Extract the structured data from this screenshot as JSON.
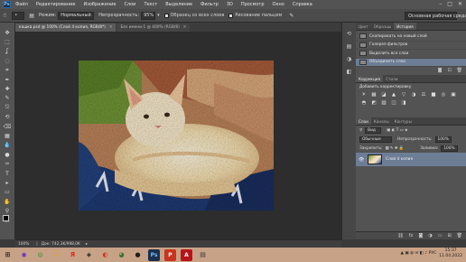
{
  "menu": {
    "logo": "Ps",
    "items": [
      "Файл",
      "Редактирование",
      "Изображение",
      "Слои",
      "Текст",
      "Выделение",
      "Фильтр",
      "3D",
      "Просмотр",
      "Окно",
      "Справка"
    ],
    "window_controls": [
      "–",
      "□",
      "✕"
    ]
  },
  "options": {
    "mode_label": "Режим:",
    "mode_value": "Нормальный",
    "opacity_label": "Непрозрачность:",
    "opacity_value": "95%",
    "all_layers_label": "Образец со всех слоев",
    "finger_paint_label": "Рисование пальцем",
    "workspace": "Основная рабочая среда"
  },
  "doc_tabs": [
    {
      "label": "кошка.psd @ 100% (Слой 4 копия, RGB/8*)",
      "active": true
    },
    {
      "label": "Без имени-1 @ 400% (RGB/8)",
      "active": false
    }
  ],
  "toolbar": {
    "icons": [
      "move-icon",
      "marquee-icon",
      "lasso-icon",
      "quick-select-icon",
      "crop-icon",
      "eyedropper-icon",
      "healing-icon",
      "brush-icon",
      "clone-stamp-icon",
      "history-brush-icon",
      "eraser-icon",
      "gradient-icon",
      "blur-icon",
      "dodge-icon",
      "pen-icon",
      "type-icon",
      "path-select-icon",
      "shape-icon",
      "hand-icon",
      "zoom-icon",
      "extra-icon"
    ],
    "glyphs": [
      "✥",
      "⬚",
      "ʆ",
      "◌",
      "⌗",
      "✒",
      "✚",
      "✎",
      "⎋",
      "⟲",
      "⌫",
      "▦",
      "💧",
      "●",
      "✑",
      "T",
      "▸",
      "▭",
      "✋",
      "⚲",
      "…"
    ],
    "fg_color": "#000000",
    "bg_color": "#ffffff"
  },
  "status": {
    "zoom": "100%",
    "doc_size": "Док: 742,3K/998,0K"
  },
  "dock_icons": [
    "history-dock-icon",
    "properties-dock-icon",
    "adjust-dock-icon",
    "layers-dock-icon"
  ],
  "history_panel": {
    "tabs": [
      "Цвет",
      "Образцы",
      "История"
    ],
    "active_tab": 2,
    "items": [
      {
        "label": "Скопировать на новый слой",
        "selected": false
      },
      {
        "label": "Галерея фильтров",
        "selected": false
      },
      {
        "label": "Выделить все слои",
        "selected": false
      },
      {
        "label": "Объединить слои",
        "selected": true
      }
    ]
  },
  "adjust_panel": {
    "tabs": [
      "Коррекция",
      "Стили"
    ],
    "active_tab": 0,
    "title": "Добавить корректировку",
    "glyphs": [
      "☀",
      "▦",
      "◪",
      "▲",
      "▽",
      "◑",
      "⚖",
      "■",
      "◎",
      "▣",
      "◓",
      "◩",
      "▨",
      "◫",
      "◨"
    ]
  },
  "layers_panel": {
    "tabs": [
      "Слои",
      "Каналы",
      "Контуры"
    ],
    "active_tab": 0,
    "kind_label": "Вид",
    "blend": "Обычные",
    "opacity_label": "Непрозрачность:",
    "opacity_value": "100%",
    "lock_label": "Закрепить:",
    "fill_label": "Заливка:",
    "fill_value": "100%",
    "layers": [
      {
        "name": "Слой 4 копия",
        "selected": true
      }
    ]
  },
  "taskbar": {
    "items": [
      {
        "glyph": "⊞",
        "color": "#1e1e1e",
        "bg": "",
        "name": "start-icon"
      },
      {
        "glyph": "◉",
        "color": "#6a2cc9",
        "bg": "",
        "name": "app-icon"
      },
      {
        "glyph": "◎",
        "color": "#1a8a2a",
        "bg": "",
        "name": "app-icon"
      },
      {
        "glyph": "🗀",
        "color": "#d9a21f",
        "bg": "",
        "name": "folder-icon"
      },
      {
        "glyph": "Я",
        "color": "#e0261b",
        "bg": "",
        "name": "yandex-icon"
      },
      {
        "glyph": "◈",
        "color": "#222",
        "bg": "",
        "name": "app-icon"
      },
      {
        "glyph": "◐",
        "color": "#d9291c",
        "bg": "",
        "name": "opera-icon"
      },
      {
        "glyph": "◕",
        "color": "#2b7a2b",
        "bg": "",
        "name": "chrome-icon"
      },
      {
        "glyph": "●",
        "color": "#1e1e1e",
        "bg": "",
        "name": "app-icon"
      },
      {
        "glyph": "Ps",
        "color": "#7bbcf5",
        "bg": "#1a2f4f",
        "name": "photoshop-icon"
      },
      {
        "glyph": "P",
        "color": "#ffffff",
        "bg": "#c8341e",
        "name": "powerpoint-icon"
      },
      {
        "glyph": "A",
        "color": "#ffffff",
        "bg": "#b8131a",
        "name": "acrobat-icon"
      },
      {
        "glyph": "▤",
        "color": "#333",
        "bg": "",
        "name": "app-icon"
      }
    ],
    "tray_icons": "▲ ▣ ◍ ✉ ◧ ♪ РУС",
    "time": "15:37",
    "date": "11.04.2022"
  }
}
